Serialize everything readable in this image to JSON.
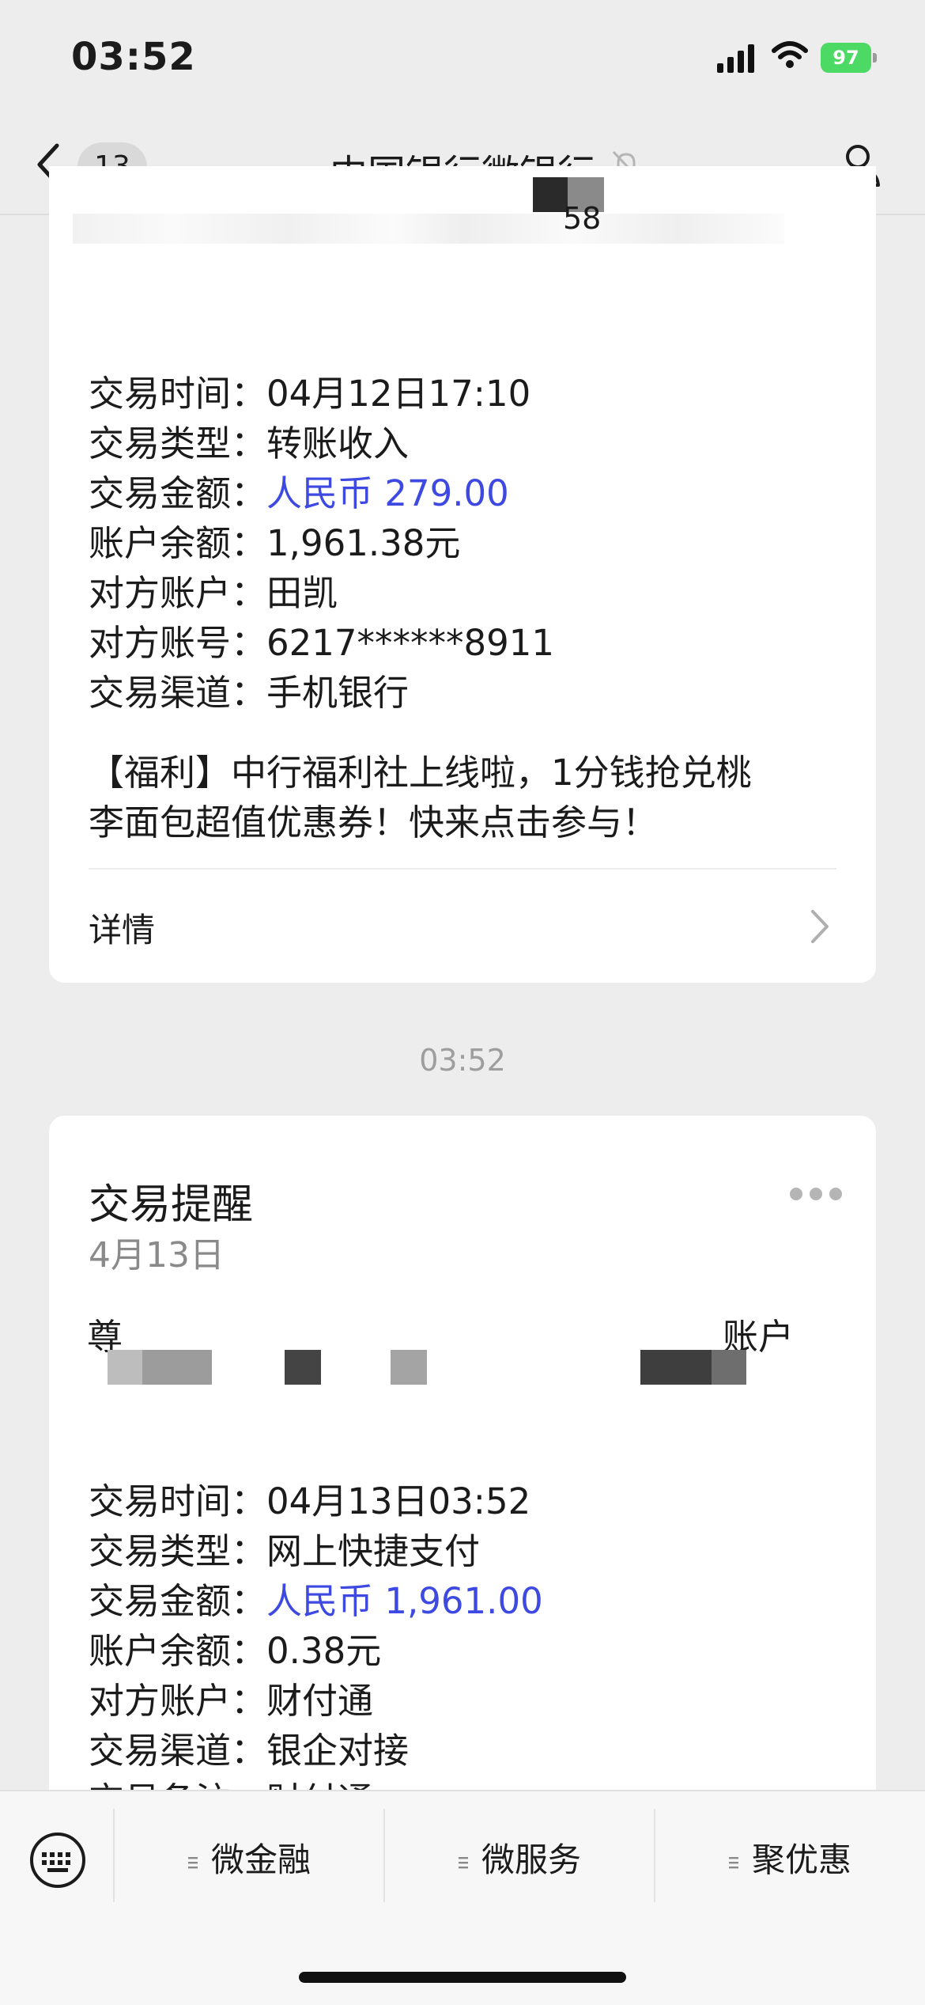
{
  "status_bar": {
    "time": "03:52",
    "battery": "97"
  },
  "nav": {
    "back_count": "13",
    "title": "中国银行微银行"
  },
  "card1": {
    "partial_text": "58",
    "rows": [
      {
        "label": "交易时间：",
        "value": "04月12日17:10"
      },
      {
        "label": "交易类型：",
        "value": "转账收入"
      },
      {
        "label": "交易金额：",
        "value": "人民币 279.00"
      },
      {
        "label": "账户余额：",
        "value": "1,961.38元"
      },
      {
        "label": "对方账户：",
        "value": "田凯"
      },
      {
        "label": "对方账号：",
        "value": "6217******8911"
      },
      {
        "label": "交易渠道：",
        "value": "手机银行"
      }
    ],
    "promo_line1": "【福利】中行福利社上线啦，1分钱抢兑桃",
    "promo_line2": "李面包超值优惠券！快来点击参与！",
    "detail": "详情"
  },
  "timestamp": "03:52",
  "card2": {
    "title": "交易提醒",
    "date": "4月13日",
    "partial_left": "尊",
    "partial_right": "账户",
    "rows": [
      {
        "label": "交易时间：",
        "value": "04月13日03:52"
      },
      {
        "label": "交易类型：",
        "value": "网上快捷支付"
      },
      {
        "label": "交易金额：",
        "value": "人民币 1,961.00"
      },
      {
        "label": "账户余额：",
        "value": "0.38元"
      },
      {
        "label": "对方账户：",
        "value": "财付通"
      },
      {
        "label": "交易渠道：",
        "value": "银企对接"
      },
      {
        "label": "交易备注：",
        "value": "财付通"
      }
    ]
  },
  "bottom_menu": {
    "items": [
      "微金融",
      "微服务",
      "聚优惠"
    ]
  },
  "colors": {
    "amount_blue": "#3d49e0",
    "battery_green": "#4cd964"
  },
  "icons": [
    "back-chevron-icon",
    "mute-bell-icon",
    "profile-icon",
    "more-dots-icon",
    "keyboard-icon",
    "menu-lines-icon",
    "chevron-right-icon"
  ]
}
